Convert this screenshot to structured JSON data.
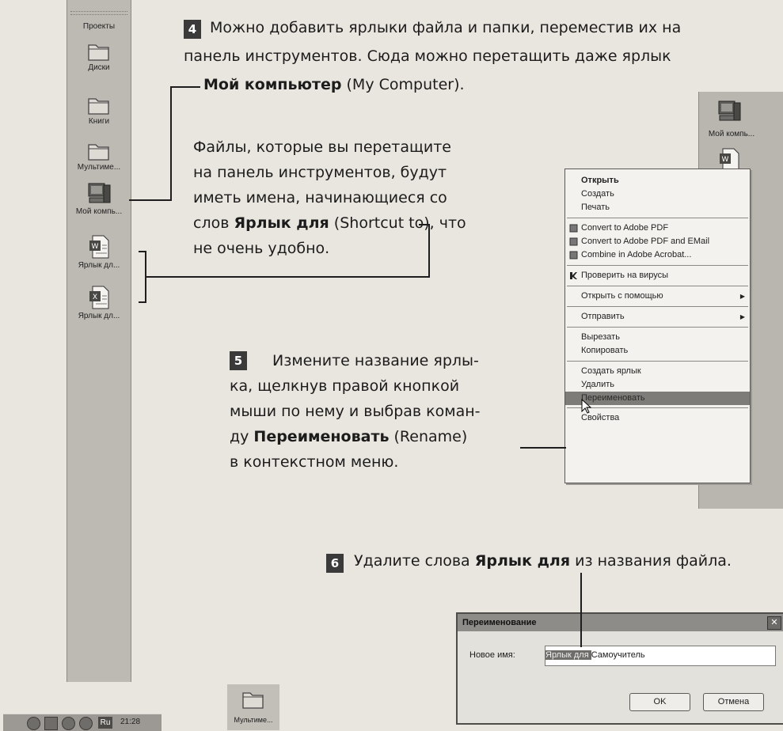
{
  "left_toolbar": {
    "items": [
      {
        "label": "Проекты",
        "icon": "folder-icon"
      },
      {
        "label": "Диски",
        "icon": "folder-icon"
      },
      {
        "label": "Книги",
        "icon": "folder-icon"
      },
      {
        "label": "Мультиме...",
        "icon": "folder-icon"
      },
      {
        "label": "Мой компь...",
        "icon": "computer-icon"
      },
      {
        "label": "Ярлык дл...",
        "icon": "word-doc-icon"
      },
      {
        "label": "Ярлык дл...",
        "icon": "excel-doc-icon"
      }
    ]
  },
  "taskbar": {
    "lang": "Ru",
    "time": "21:28"
  },
  "bottom_folder": {
    "label": "Мультиме..."
  },
  "step4": {
    "num": "4",
    "line1": "Можно добавить ярлыки файла и папки, переместив их на",
    "line2": "панель инструментов. Сюда можно перетащить даже ярлык",
    "line3_bold": "Мой компьютер",
    "line3_rest": " (My Computer)."
  },
  "note": {
    "l1": "Файлы, которые вы перетащите",
    "l2": "на панель инструментов, будут",
    "l3": "иметь имена, начинающиеся со",
    "l4_pre": "слов ",
    "l4_bold": "Ярлык для",
    "l4_rest": " (Shortcut to), что",
    "l5": "не очень удобно."
  },
  "step5": {
    "num": "5",
    "l1": "Измените название ярлы-",
    "l2": "ка, щелкнув правой кнопкой",
    "l3": "мыши по нему и выбрав коман-",
    "l4_pre": "ду ",
    "l4_bold": "Переименовать",
    "l4_rest": " (Rename)",
    "l5": "в контекстном меню."
  },
  "step6": {
    "num": "6",
    "pre": "Удалите слова ",
    "bold": "Ярлык для",
    "rest": " из названия файла."
  },
  "right_toolbar": {
    "label": "Мой компь..."
  },
  "context_menu": {
    "items": [
      {
        "label": "Открыть"
      },
      {
        "label": "Создать"
      },
      {
        "label": "Печать"
      },
      {
        "label": "Convert to Adobe PDF"
      },
      {
        "label": "Convert to Adobe PDF and EMail"
      },
      {
        "label": "Combine in Adobe Acrobat..."
      },
      {
        "label": "Проверить на вирусы"
      },
      {
        "label": "Открыть с помощью"
      },
      {
        "label": "Отправить"
      },
      {
        "label": "Вырезать"
      },
      {
        "label": "Копировать"
      },
      {
        "label": "Создать ярлык"
      },
      {
        "label": "Удалить"
      },
      {
        "label": "Переименовать"
      },
      {
        "label": "Свойства"
      }
    ]
  },
  "rename_dialog": {
    "title": "Переименование",
    "field_label": "Новое имя:",
    "value_selected": "Ярлык для ",
    "value_rest": "Самоучитель",
    "ok": "OK",
    "cancel": "Отмена"
  }
}
